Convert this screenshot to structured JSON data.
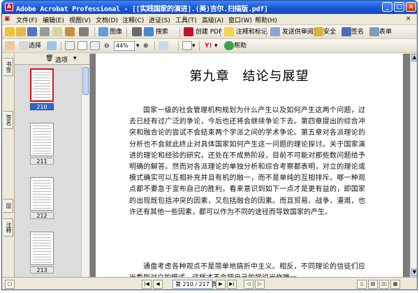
{
  "window": {
    "title": "Adobe Acrobat Professional - [[实践国家的演进].(美)吉尔.扫描版.pdf]"
  },
  "menu": [
    "文件(F)",
    "编辑(E)",
    "视图(V)",
    "文档(D)",
    "注释(C)",
    "进证(S)",
    "工具(T)",
    "高级(A)",
    "窗口(W)",
    "帮助(H)"
  ],
  "toolbar1": {
    "search": "搜索",
    "create_pdf": "创建 PDF",
    "review_comment": "注释和标记",
    "send_for_review": "发送供审阅",
    "secure": "安全",
    "sign": "签名",
    "forms": "表单"
  },
  "toolbar2": {
    "select": "选择",
    "zoom": "44%",
    "help": "帮助"
  },
  "side_tabs": [
    "书签",
    "签名",
    "层",
    "注释"
  ],
  "pane": {
    "options": "选项"
  },
  "thumbnails": [
    {
      "label": "210",
      "selected": true
    },
    {
      "label": "211",
      "selected": false
    },
    {
      "label": "212",
      "selected": false
    },
    {
      "label": "213",
      "selected": false
    }
  ],
  "document": {
    "chapter_title": "第九章　结论与展望",
    "paragraph1": "国家一级的社会管理机构规划为什么产生以及如何产生这两个问题，过去已经有过广泛的争论，今后也还将会继续争论下去。第四章提出的综合冲突和融合论的尝试不会结束两个学派之间的学术争论。第五章对各派理论的分析也不会就此终止对具体国家如何产生这一问题的理论探讨。关于国家演进的理论和经验的研究，还处在不成熟阶段，目前不可能对那些数问题给予明确的解答。然而对各派理论的单独分析和综合考察都表明，对立的理论或模式确实可以互相补充并且有机的融一，而不是单纯的互相排斥。哪一种观点都不要急于宣布自己的胜利。看来意识到如下一点才是更有益的，即国家的出现既包括冲突的因素，又包括融合的因素。而且贸易、战争、灌溉，也许还有其他一些因素，都可以作为不同的途径而导致国家的产生。",
    "paragraph2": "通盘考虑各种观点不是简单地搞折中主义。相反，不同理论的信徒们应当看到对立的模式，这样才不会把自己的学说当作唯一"
  },
  "status": {
    "page_indicator": "第 210 / 217 页"
  }
}
